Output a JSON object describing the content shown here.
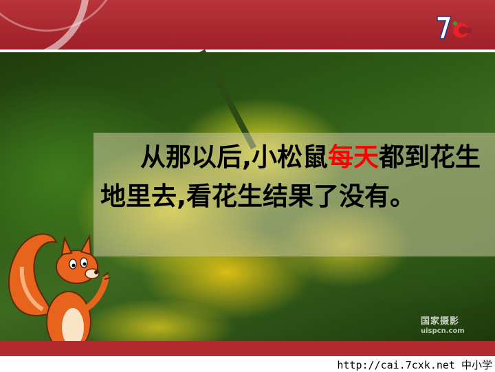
{
  "brand": {
    "logo_text": "7c"
  },
  "passage": {
    "segment_1": "从那以后,小松鼠",
    "highlight": "每天",
    "segment_2": "都到花生地里去,看花生结果了没有。"
  },
  "photo_watermark": {
    "name": "国家摄影",
    "url": "uispcn.com"
  },
  "footer": {
    "url_text": "http://cai.7cxk.net 中小学"
  },
  "colors": {
    "header": "#9e2028",
    "highlight": "#ff0000",
    "panel": "#cdc8a0"
  },
  "icons": [
    "squirrel-illustration",
    "brand-logo-icon"
  ]
}
